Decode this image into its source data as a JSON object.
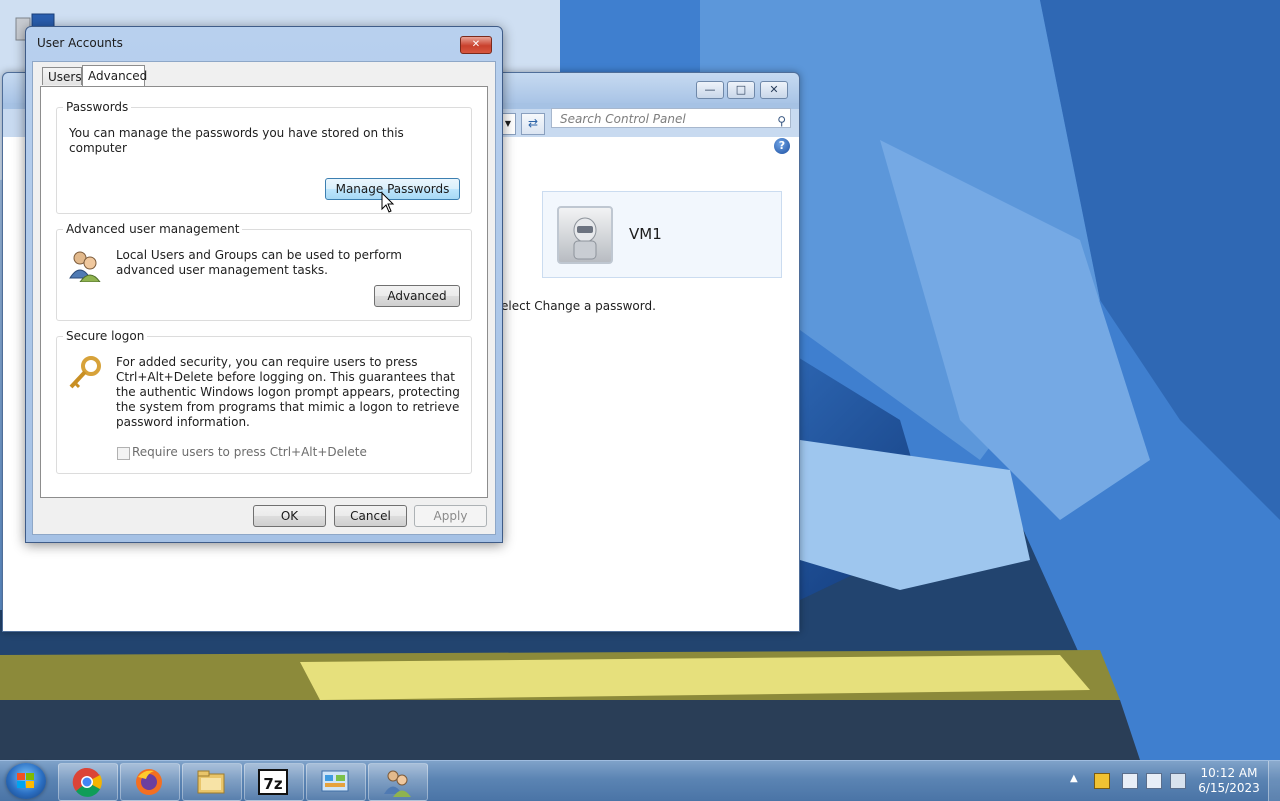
{
  "dialog": {
    "title": "User Accounts",
    "tabs": [
      {
        "label": "Users"
      },
      {
        "label": "Advanced"
      }
    ],
    "passwords": {
      "heading": "Passwords",
      "text": "You can manage the passwords you have stored on this computer",
      "button": "Manage Passwords"
    },
    "advanced_mgmt": {
      "heading": "Advanced user management",
      "text": "Local Users and Groups can be used to perform advanced user management tasks.",
      "button": "Advanced"
    },
    "secure_logon": {
      "heading": "Secure logon",
      "text": "For added security, you can require users to press Ctrl+Alt+Delete before logging on. This guarantees that the authentic Windows logon prompt appears, protecting the system from programs that mimic a logon to retrieve password information.",
      "checkbox_label": "Require users to press Ctrl+Alt+Delete",
      "checkbox_checked": false
    },
    "buttons": {
      "ok": "OK",
      "cancel": "Cancel",
      "apply": "Apply"
    }
  },
  "control_panel": {
    "search_placeholder": "Search Control Panel",
    "user_name": "VM1",
    "hint_text": "elect Change a password."
  },
  "taskbar": {
    "apps": [
      {
        "name": "Google Chrome"
      },
      {
        "name": "Firefox"
      },
      {
        "name": "File Explorer"
      },
      {
        "name": "7-Zip"
      },
      {
        "name": "Control Panel"
      },
      {
        "name": "User Accounts"
      }
    ],
    "clock": {
      "time": "10:12 AM",
      "date": "6/15/2023"
    }
  },
  "colors": {
    "accent": "#3c7fb1",
    "close_red": "#c9412d",
    "taskbar": "#5b84b3"
  }
}
